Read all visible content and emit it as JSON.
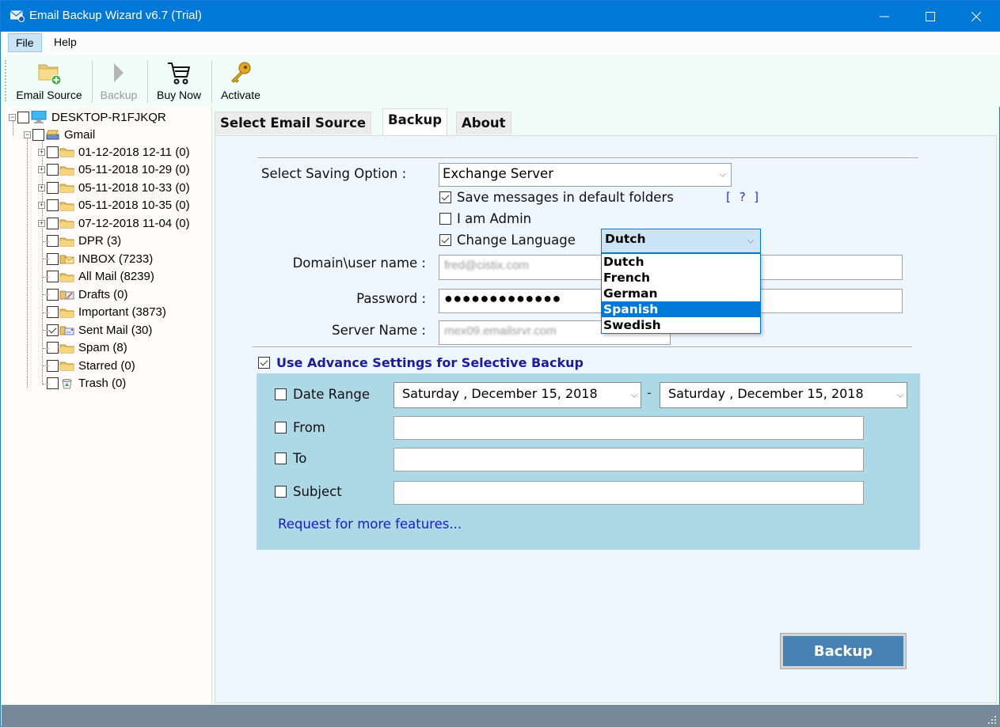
{
  "window": {
    "title": "Email Backup Wizard v6.7 (Trial)",
    "controls": {
      "minimize": "—",
      "maximize": "☐",
      "close": "✕"
    }
  },
  "menubar": {
    "items": [
      "File",
      "Help"
    ]
  },
  "toolbar": {
    "buttons": [
      {
        "label": "Email Source",
        "icon": "folder-add-icon",
        "enabled": true
      },
      {
        "label": "Backup",
        "icon": "play-icon",
        "enabled": false
      },
      {
        "label": "Buy Now",
        "icon": "cart-icon",
        "enabled": true
      },
      {
        "label": "Activate",
        "icon": "key-icon",
        "enabled": true
      }
    ]
  },
  "tree": {
    "root": {
      "label": "DESKTOP-R1FJKQR",
      "icon": "computer-icon",
      "checked": false,
      "expanded": true
    },
    "account": {
      "label": "Gmail",
      "icon": "mail-stack-icon",
      "checked": false,
      "expanded": true
    },
    "folders": [
      {
        "label": "01-12-2018 12-11 (0)",
        "icon": "folder-icon",
        "checked": false,
        "expandable": true
      },
      {
        "label": "05-11-2018 10-29 (0)",
        "icon": "folder-icon",
        "checked": false,
        "expandable": true
      },
      {
        "label": "05-11-2018 10-33 (0)",
        "icon": "folder-icon",
        "checked": false,
        "expandable": true
      },
      {
        "label": "05-11-2018 10-35 (0)",
        "icon": "folder-icon",
        "checked": false,
        "expandable": true
      },
      {
        "label": "07-12-2018 11-04 (0)",
        "icon": "folder-icon",
        "checked": false,
        "expandable": true
      },
      {
        "label": "DPR (3)",
        "icon": "folder-icon",
        "checked": false,
        "expandable": false
      },
      {
        "label": "INBOX (7233)",
        "icon": "inbox-folder-icon",
        "checked": false,
        "expandable": false
      },
      {
        "label": "All Mail (8239)",
        "icon": "folder-icon",
        "checked": false,
        "expandable": false
      },
      {
        "label": "Drafts (0)",
        "icon": "drafts-folder-icon",
        "checked": false,
        "expandable": false
      },
      {
        "label": "Important (3873)",
        "icon": "folder-icon",
        "checked": false,
        "expandable": false
      },
      {
        "label": "Sent Mail (30)",
        "icon": "sent-folder-icon",
        "checked": true,
        "expandable": false
      },
      {
        "label": "Spam (8)",
        "icon": "folder-icon",
        "checked": false,
        "expandable": false
      },
      {
        "label": "Starred (0)",
        "icon": "folder-icon",
        "checked": false,
        "expandable": false
      },
      {
        "label": "Trash (0)",
        "icon": "trash-icon",
        "checked": false,
        "expandable": false
      }
    ]
  },
  "tabs": [
    {
      "label": "Select Email Source",
      "active": false
    },
    {
      "label": "Backup",
      "active": true
    },
    {
      "label": "About",
      "active": false
    }
  ],
  "backup": {
    "saving_option_label": "Select Saving Option :",
    "saving_option_value": "Exchange Server",
    "save_default_folders": {
      "label": "Save messages in default folders",
      "checked": true
    },
    "help_link": "[ ? ]",
    "i_am_admin": {
      "label": "I am Admin",
      "checked": false
    },
    "change_language": {
      "label": "Change Language",
      "checked": true
    },
    "language": {
      "value": "Dutch",
      "options": [
        "Dutch",
        "French",
        "German",
        "Spanish",
        "Swedish"
      ],
      "highlighted": "Spanish"
    },
    "domain_user_label": "Domain\\user name :",
    "domain_user_value": "fred@cistix.com",
    "password_label": "Password :",
    "password_value": "●●●●●●●●●●●●●",
    "server_name_label": "Server Name :",
    "server_name_value": "mex09.emailsrvr.com",
    "advanced": {
      "label": "Use Advance Settings for Selective Backup",
      "checked": true,
      "date_range": {
        "label": "Date Range",
        "checked": false,
        "from": "Saturday  ,  December  15, 2018",
        "to": "Saturday  ,  December  15, 2018",
        "separator": "-"
      },
      "from": {
        "label": "From",
        "checked": false,
        "value": ""
      },
      "to": {
        "label": "To",
        "checked": false,
        "value": ""
      },
      "subject": {
        "label": "Subject",
        "checked": false,
        "value": ""
      },
      "more_features_link": "Request for more features..."
    },
    "backup_button": "Backup"
  },
  "colors": {
    "titlebar": "#0078d7",
    "accent": "#4682b4",
    "advanced_box": "#add8e6",
    "statusbar": "#778899",
    "selection": "#0078d7"
  }
}
